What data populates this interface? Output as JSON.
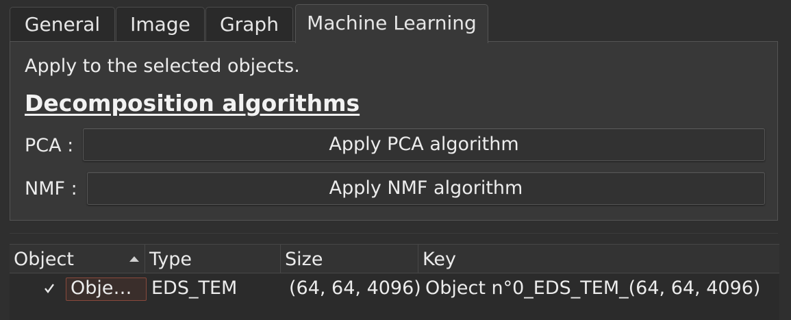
{
  "tabs": [
    {
      "label": "General"
    },
    {
      "label": "Image"
    },
    {
      "label": "Graph"
    },
    {
      "label": "Machine Learning",
      "active": true
    }
  ],
  "panel": {
    "hint": "Apply to the selected objects.",
    "section_title": "Decomposition algorithms",
    "pca": {
      "label": "PCA :",
      "button": "Apply PCA algorithm"
    },
    "nmf": {
      "label": "NMF :",
      "button": "Apply NMF algorithm"
    }
  },
  "table": {
    "headers": [
      "Object",
      "Type",
      "Size",
      "Key"
    ],
    "rows": [
      {
        "checked": true,
        "object": "Obje…",
        "type": "EDS_TEM",
        "size": "(64, 64, 4096)",
        "key": "Object n°0_EDS_TEM_(64, 64, 4096)"
      }
    ]
  },
  "colors": {
    "background": "#2f2f2f",
    "panel": "#383838",
    "selected_cell_border": "#8a4a3c"
  }
}
